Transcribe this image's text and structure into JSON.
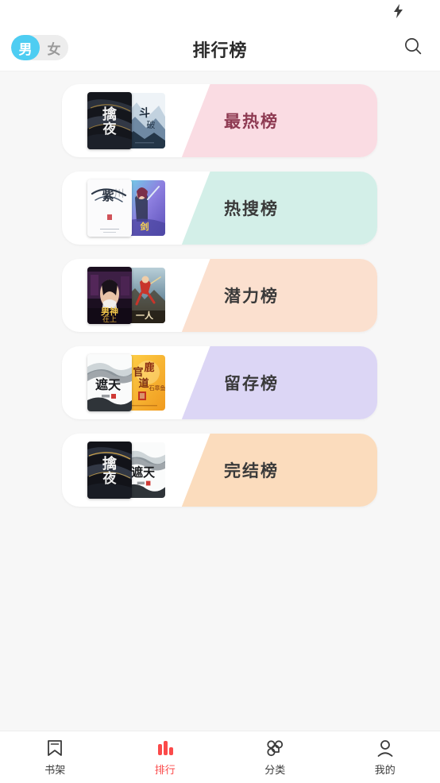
{
  "statusbar": {
    "bolt_icon": "lightning-bolt-icon",
    "bolt_glyph": "⚡"
  },
  "header": {
    "title": "排行榜",
    "gender": {
      "male": "男",
      "female": "女",
      "selected": "男",
      "active_color": "#4ecdf2"
    },
    "search_icon": "search-icon"
  },
  "rankings": [
    {
      "label": "最热榜",
      "bg_color": "#fadce3",
      "text_color": "#8e3a52",
      "covers": {
        "front": "dark-ink-calligraphy-cover",
        "back": "blue-mountain-cover"
      }
    },
    {
      "label": "热搜榜",
      "bg_color": "#d3efe8",
      "text_color": "#3a3a3a",
      "covers": {
        "front": "white-calligraphy-cover",
        "back": "purple-swordsman-cover"
      }
    },
    {
      "label": "潜力榜",
      "bg_color": "#fbe0cf",
      "text_color": "#3a3a3a",
      "covers": {
        "front": "purple-city-romance-cover",
        "back": "red-warrior-action-cover"
      }
    },
    {
      "label": "留存榜",
      "bg_color": "#dcd6f5",
      "text_color": "#3a3a3a",
      "covers": {
        "front": "white-landscape-cover",
        "back": "yellow-gold-cover"
      }
    },
    {
      "label": "完结榜",
      "bg_color": "#fbdcbd",
      "text_color": "#3a3a3a",
      "covers": {
        "front": "dark-gold-calligraphy-cover",
        "back": "white-landscape-cover"
      }
    }
  ],
  "tabbar": {
    "items": [
      {
        "label": "书架",
        "icon": "bookmark-icon",
        "active": false
      },
      {
        "label": "排行",
        "icon": "bar-chart-icon",
        "active": true
      },
      {
        "label": "分类",
        "icon": "grid-circles-icon",
        "active": false
      },
      {
        "label": "我的",
        "icon": "user-icon",
        "active": false
      }
    ],
    "active_color": "#fb4a4a"
  }
}
